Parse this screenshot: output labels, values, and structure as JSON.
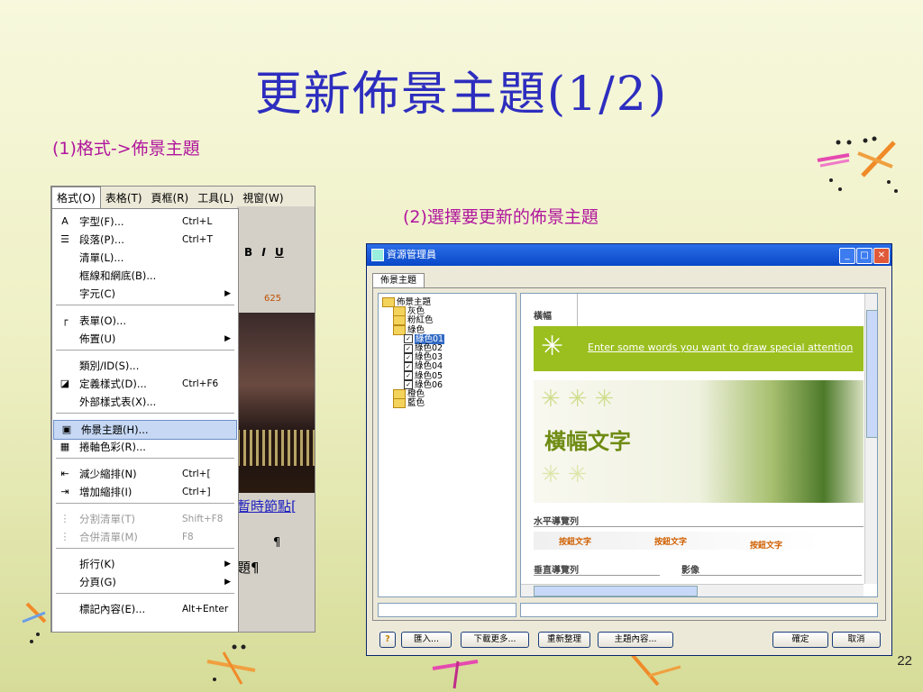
{
  "slide": {
    "title": "更新佈景主題(1/2)",
    "step1": "(1)格式->佈景主題",
    "step2": "(2)選擇要更新的佈景主題",
    "page_number": "22"
  },
  "left_screenshot": {
    "menubar": [
      "格式(O)",
      "表格(T)",
      "頁框(R)",
      "工具(L)",
      "視窗(W)"
    ],
    "menu_items": [
      {
        "icon": "A",
        "label": "字型(F)...",
        "shortcut": "Ctrl+L"
      },
      {
        "icon": "☰",
        "label": "段落(P)...",
        "shortcut": "Ctrl+T"
      },
      {
        "icon": "",
        "label": "清單(L)...",
        "shortcut": ""
      },
      {
        "icon": "",
        "label": "框線和網底(B)...",
        "shortcut": ""
      },
      {
        "icon": "",
        "label": "字元(C)",
        "shortcut": "",
        "submenu": "▶"
      },
      {
        "icon": "┌",
        "label": "表單(O)...",
        "shortcut": ""
      },
      {
        "icon": "",
        "label": "佈置(U)",
        "shortcut": "",
        "submenu": "▶"
      },
      {
        "icon": "",
        "label": "類別/ID(S)...",
        "shortcut": ""
      },
      {
        "icon": "◪",
        "label": "定義樣式(D)...",
        "shortcut": "Ctrl+F6"
      },
      {
        "icon": "",
        "label": "外部樣式表(X)...",
        "shortcut": ""
      },
      {
        "icon": "▣",
        "label": "佈景主題(H)...",
        "shortcut": ""
      },
      {
        "icon": "▦",
        "label": "捲軸色彩(R)...",
        "shortcut": ""
      },
      {
        "icon": "⇤",
        "label": "減少縮排(N)",
        "shortcut": "Ctrl+["
      },
      {
        "icon": "⇥",
        "label": "增加縮排(I)",
        "shortcut": "Ctrl+]"
      },
      {
        "icon": "⋮",
        "label": "分割清單(T)",
        "shortcut": "Shift+F8"
      },
      {
        "icon": "⋮",
        "label": "合併清單(M)",
        "shortcut": "F8"
      },
      {
        "icon": "",
        "label": "折行(K)",
        "shortcut": "",
        "submenu": "▶"
      },
      {
        "icon": "",
        "label": "分頁(G)",
        "shortcut": "",
        "submenu": "▶"
      },
      {
        "icon": "",
        "label": "標記內容(E)...",
        "shortcut": "Alt+Enter"
      }
    ],
    "ruler_text": "625",
    "bg_text1": "暫時節點[",
    "bg_text2": "題¶",
    "pilcrow": "¶",
    "toolbar_b": "B",
    "toolbar_i": "I",
    "toolbar_u": "U"
  },
  "right_screenshot": {
    "window_title": "資源管理員",
    "tab_label": "佈景主題",
    "tree": [
      {
        "label": "佈景主題",
        "level": 0
      },
      {
        "label": "灰色",
        "level": 1
      },
      {
        "label": "粉紅色",
        "level": 1
      },
      {
        "label": "綠色",
        "level": 1
      },
      {
        "label": "綠色01",
        "level": 2,
        "selected": true
      },
      {
        "label": "綠色02",
        "level": 2
      },
      {
        "label": "綠色03",
        "level": 2
      },
      {
        "label": "綠色04",
        "level": 2
      },
      {
        "label": "綠色05",
        "level": 2
      },
      {
        "label": "綠色06",
        "level": 2
      },
      {
        "label": "橙色",
        "level": 1
      },
      {
        "label": "藍色",
        "level": 1
      }
    ],
    "preview": {
      "banner_label": "橫幅",
      "banner_text": "Enter some words you want to draw special attention",
      "banner_title": "橫幅文字",
      "hnav_label": "水平導覽列",
      "nav_buttons": [
        "按鈕文字",
        "按鈕文字",
        "按鈕文字"
      ],
      "vnav_label": "垂直導覽列",
      "image_label": "影像"
    },
    "buttons": {
      "help": "?",
      "import": "匯入...",
      "download": "下載更多...",
      "refresh": "重新整理",
      "theme_content": "主題內容...",
      "ok": "確定",
      "cancel": "取消"
    },
    "colors": {
      "titlebar": "#0a48c8",
      "banner_green": "#9bbf1e",
      "accent_orange": "#d06000"
    }
  }
}
